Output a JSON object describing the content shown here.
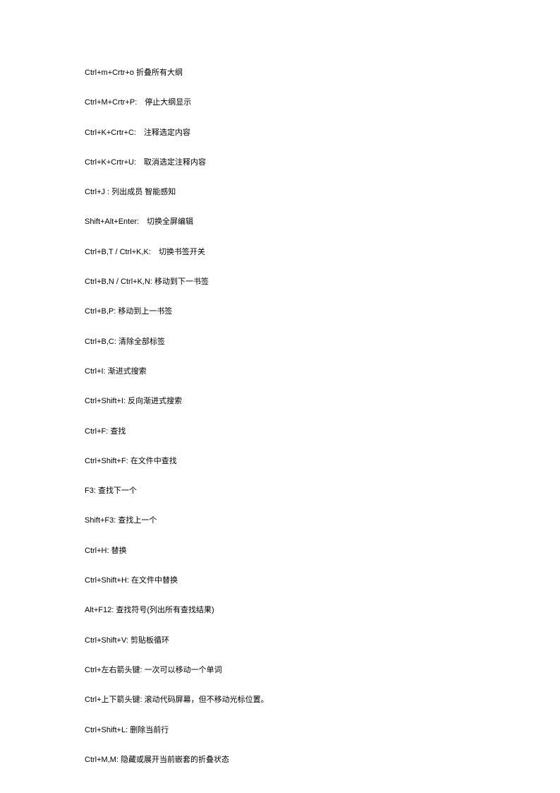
{
  "shortcuts": [
    {
      "key": "Ctrl+m+Crtr+o",
      "desc": "折叠所有大纲",
      "sep": " "
    },
    {
      "key": "Ctrl+M+Crtr+P:",
      "desc": "停止大纲显示",
      "sep": "　"
    },
    {
      "key": "Ctrl+K+Crtr+C:",
      "desc": "注释选定内容",
      "sep": "　"
    },
    {
      "key": "Ctrl+K+Crtr+U:",
      "desc": "取消选定注释内容",
      "sep": "　"
    },
    {
      "key": "Ctrl+J :",
      "desc": "列出成员  智能感知",
      "sep": "  "
    },
    {
      "key": "Shift+Alt+Enter:",
      "desc": "切换全屏编辑",
      "sep": "　"
    },
    {
      "key": "Ctrl+B,T / Ctrl+K,K:",
      "desc": "切换书签开关",
      "sep": "　"
    },
    {
      "key": "Ctrl+B,N / Ctrl+K,N:",
      "desc": "移动到下一书签",
      "sep": "  "
    },
    {
      "key": "Ctrl+B,P:",
      "desc": "移动到上一书签",
      "sep": "  "
    },
    {
      "key": "Ctrl+B,C:",
      "desc": "清除全部标签",
      "sep": "  "
    },
    {
      "key": "Ctrl+I:",
      "desc": "渐进式搜索",
      "sep": "  "
    },
    {
      "key": "Ctrl+Shift+I:",
      "desc": "反向渐进式搜索",
      "sep": "  "
    },
    {
      "key": "Ctrl+F:",
      "desc": "查找",
      "sep": "  "
    },
    {
      "key": "Ctrl+Shift+F:",
      "desc": "在文件中查找",
      "sep": "  "
    },
    {
      "key": "F3:",
      "desc": "查找下一个",
      "sep": "  "
    },
    {
      "key": "Shift+F3:",
      "desc": "查找上一个",
      "sep": "  "
    },
    {
      "key": "Ctrl+H:",
      "desc": "替换",
      "sep": "  "
    },
    {
      "key": "Ctrl+Shift+H:",
      "desc": "在文件中替换",
      "sep": "  "
    },
    {
      "key": "Alt+F12:",
      "desc": "查找符号(列出所有查找结果)",
      "sep": "  "
    },
    {
      "key": "Ctrl+Shift+V:",
      "desc": "剪贴板循环",
      "sep": "  "
    },
    {
      "key": "Ctrl+左右箭头键:",
      "desc": "一次可以移动一个单词",
      "sep": "  "
    },
    {
      "key": "Ctrl+上下箭头键:",
      "desc": "滚动代码屏幕，但不移动光标位置。",
      "sep": "  "
    },
    {
      "key": "Ctrl+Shift+L:",
      "desc": "删除当前行",
      "sep": "  "
    },
    {
      "key": "Ctrl+M,M:",
      "desc": "隐藏或展开当前嵌套的折叠状态",
      "sep": "  "
    }
  ]
}
